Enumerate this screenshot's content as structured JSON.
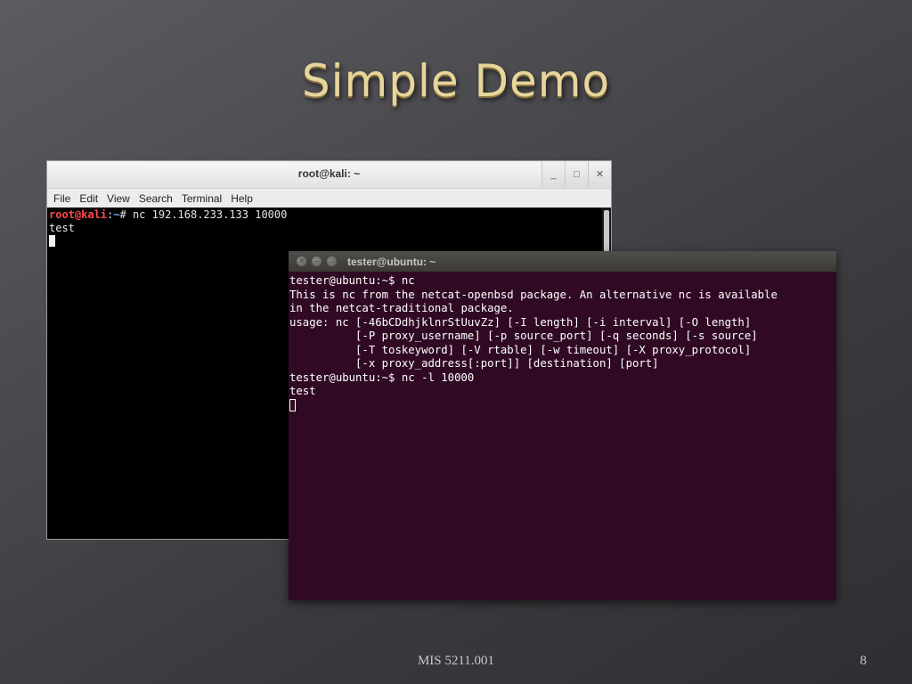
{
  "slide": {
    "title": "Simple Demo",
    "footer_course": "MIS 5211.001",
    "page_number": "8"
  },
  "kali_terminal": {
    "title": "root@kali: ~",
    "buttons": {
      "minimize": "_",
      "maximize": "□",
      "close": "✕"
    },
    "menu": [
      "File",
      "Edit",
      "View",
      "Search",
      "Terminal",
      "Help"
    ],
    "prompt_user": "root@kali",
    "prompt_sep": ":",
    "prompt_path": "~",
    "prompt_symbol": "#",
    "command": " nc 192.168.233.133 10000",
    "output": "test"
  },
  "ubuntu_terminal": {
    "title": "tester@ubuntu: ~",
    "lines": [
      "tester@ubuntu:~$ nc",
      "This is nc from the netcat-openbsd package. An alternative nc is available",
      "in the netcat-traditional package.",
      "usage: nc [-46bCDdhjklnrStUuvZz] [-I length] [-i interval] [-O length]",
      "          [-P proxy_username] [-p source_port] [-q seconds] [-s source]",
      "          [-T toskeyword] [-V rtable] [-w timeout] [-X proxy_protocol]",
      "          [-x proxy_address[:port]] [destination] [port]",
      "tester@ubuntu:~$ nc -l 10000",
      "test"
    ]
  },
  "colors": {
    "slide_title": "#e8d59c",
    "ubuntu_bg": "#300a24",
    "kali_prompt_user": "#ff4a4a",
    "kali_prompt_path": "#7aa6ff"
  }
}
